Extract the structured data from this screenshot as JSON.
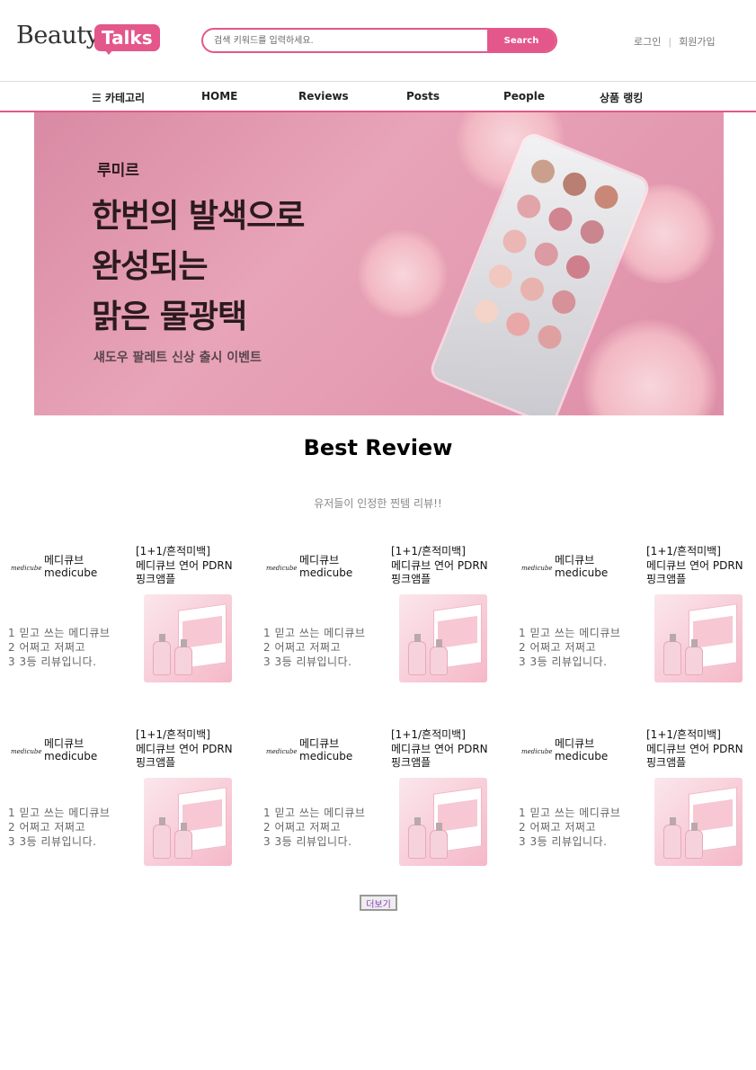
{
  "header": {
    "logo_beauty": "Beauty",
    "logo_talks": "Talks",
    "search_placeholder": "검색 키워드를 입력하세요.",
    "search_button": "Search",
    "login": "로그인",
    "separator": "|",
    "signup": "회원가입"
  },
  "nav": {
    "category": "☰ 카테고리",
    "home": "HOME",
    "reviews": "Reviews",
    "posts": "Posts",
    "people": "People",
    "ranking": "상품 랭킹"
  },
  "banner": {
    "brand": "루미르",
    "line1": "한번의 발색으로",
    "line2": "완성되는",
    "line3": "맑은 물광택",
    "sub": "섀도우 팔레트 신상 출시 이벤트"
  },
  "best": {
    "title": "Best Review",
    "subtitle": "유저들이 인정한 찐템 리뷰!!"
  },
  "reviews": [
    {
      "logo": "medicube",
      "brand_ko": "메디큐브",
      "brand_en": "medicube",
      "title_1": "[1+1/흔적미백]",
      "title_2": "메디큐브 연어 PDRN",
      "title_3": "핑크앰플",
      "line1": "1 믿고 쓰는 메디큐브",
      "line2": "2 어쩌고 저쩌고",
      "line3": "3 3등 리뷰입니다."
    },
    {
      "logo": "medicube",
      "brand_ko": "메디큐브",
      "brand_en": "medicube",
      "title_1": "[1+1/흔적미백]",
      "title_2": "메디큐브 연어 PDRN",
      "title_3": "핑크앰플",
      "line1": "1 믿고 쓰는 메디큐브",
      "line2": "2 어쩌고 저쩌고",
      "line3": "3 3등 리뷰입니다."
    },
    {
      "logo": "medicube",
      "brand_ko": "메디큐브",
      "brand_en": "medicube",
      "title_1": "[1+1/흔적미백]",
      "title_2": "메디큐브 연어 PDRN",
      "title_3": "핑크앰플",
      "line1": "1 믿고 쓰는 메디큐브",
      "line2": "2 어쩌고 저쩌고",
      "line3": "3 3등 리뷰입니다."
    },
    {
      "logo": "medicube",
      "brand_ko": "메디큐브",
      "brand_en": "medicube",
      "title_1": "[1+1/흔적미백]",
      "title_2": "메디큐브 연어 PDRN",
      "title_3": "핑크앰플",
      "line1": "1 믿고 쓰는 메디큐브",
      "line2": "2 어쩌고 저쩌고",
      "line3": "3 3등 리뷰입니다."
    },
    {
      "logo": "medicube",
      "brand_ko": "메디큐브",
      "brand_en": "medicube",
      "title_1": "[1+1/흔적미백]",
      "title_2": "메디큐브 연어 PDRN",
      "title_3": "핑크앰플",
      "line1": "1 믿고 쓰는 메디큐브",
      "line2": "2 어쩌고 저쩌고",
      "line3": "3 3등 리뷰입니다."
    },
    {
      "logo": "medicube",
      "brand_ko": "메디큐브",
      "brand_en": "medicube",
      "title_1": "[1+1/흔적미백]",
      "title_2": "메디큐브 연어 PDRN",
      "title_3": "핑크앰플",
      "line1": "1 믿고 쓰는 메디큐브",
      "line2": "2 어쩌고 저쩌고",
      "line3": "3 3등 리뷰입니다."
    }
  ],
  "more_button": "더보기",
  "colors": {
    "accent": "#e4578a",
    "banner_bg": "#dd8ea8"
  }
}
